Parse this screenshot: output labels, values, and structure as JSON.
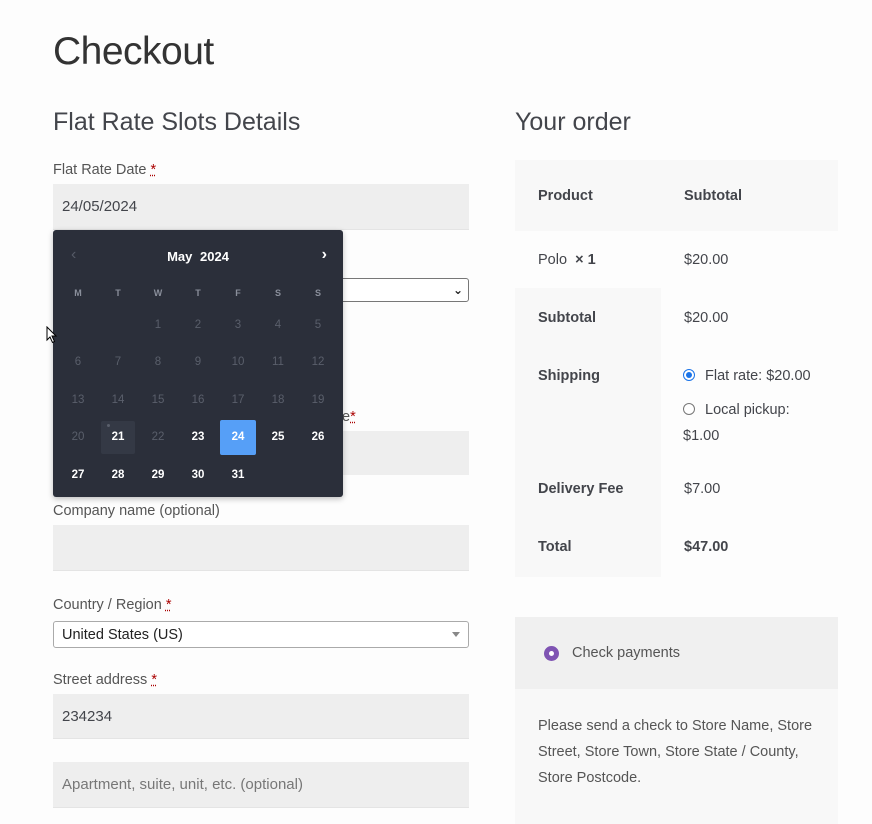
{
  "page": {
    "title": "Checkout"
  },
  "left": {
    "heading": "Flat Rate Slots Details",
    "date_label": "Flat Rate Date",
    "required_mark": "*",
    "date_value": "24/05/2024",
    "partial_label": "e",
    "company_label": "Company name (optional)",
    "country_label": "Country / Region",
    "country_value": "United States (US)",
    "street_label": "Street address",
    "street_value": "234234",
    "apartment_placeholder": "Apartment, suite, unit, etc. (optional)"
  },
  "calendar": {
    "month": "May",
    "year": "2024",
    "weekdays": [
      "M",
      "T",
      "W",
      "T",
      "F",
      "S",
      "S"
    ],
    "days": [
      {
        "d": "",
        "s": "empty"
      },
      {
        "d": "",
        "s": "empty"
      },
      {
        "d": "1",
        "s": "disabled"
      },
      {
        "d": "2",
        "s": "disabled"
      },
      {
        "d": "3",
        "s": "disabled"
      },
      {
        "d": "4",
        "s": "disabled"
      },
      {
        "d": "5",
        "s": "disabled"
      },
      {
        "d": "6",
        "s": "disabled"
      },
      {
        "d": "7",
        "s": "disabled"
      },
      {
        "d": "8",
        "s": "disabled"
      },
      {
        "d": "9",
        "s": "disabled"
      },
      {
        "d": "10",
        "s": "disabled"
      },
      {
        "d": "11",
        "s": "disabled"
      },
      {
        "d": "12",
        "s": "disabled"
      },
      {
        "d": "13",
        "s": "disabled"
      },
      {
        "d": "14",
        "s": "disabled"
      },
      {
        "d": "15",
        "s": "disabled"
      },
      {
        "d": "16",
        "s": "disabled"
      },
      {
        "d": "17",
        "s": "disabled"
      },
      {
        "d": "18",
        "s": "disabled"
      },
      {
        "d": "19",
        "s": "disabled"
      },
      {
        "d": "20",
        "s": "disabled"
      },
      {
        "d": "21",
        "s": "today"
      },
      {
        "d": "22",
        "s": "disabled"
      },
      {
        "d": "23",
        "s": "active"
      },
      {
        "d": "24",
        "s": "selected"
      },
      {
        "d": "25",
        "s": "active"
      },
      {
        "d": "26",
        "s": "active"
      },
      {
        "d": "27",
        "s": "active"
      },
      {
        "d": "28",
        "s": "active"
      },
      {
        "d": "29",
        "s": "active"
      },
      {
        "d": "30",
        "s": "active"
      },
      {
        "d": "31",
        "s": "active"
      }
    ]
  },
  "order": {
    "heading": "Your order",
    "col_product": "Product",
    "col_subtotal": "Subtotal",
    "item_name": "Polo",
    "item_qty": "× 1",
    "item_price": "$20.00",
    "subtotal_label": "Subtotal",
    "subtotal_value": "$20.00",
    "shipping_label": "Shipping",
    "shipping_option1": "Flat rate: $20.00",
    "shipping_option2_a": "Local pickup:",
    "shipping_option2_b": "$1.00",
    "delivery_label": "Delivery Fee",
    "delivery_value": "$7.00",
    "total_label": "Total",
    "total_value": "$47.00"
  },
  "payment": {
    "method": "Check payments",
    "description": "Please send a check to Store Name, Store Street, Store Town, Store State / County, Store Postcode."
  }
}
